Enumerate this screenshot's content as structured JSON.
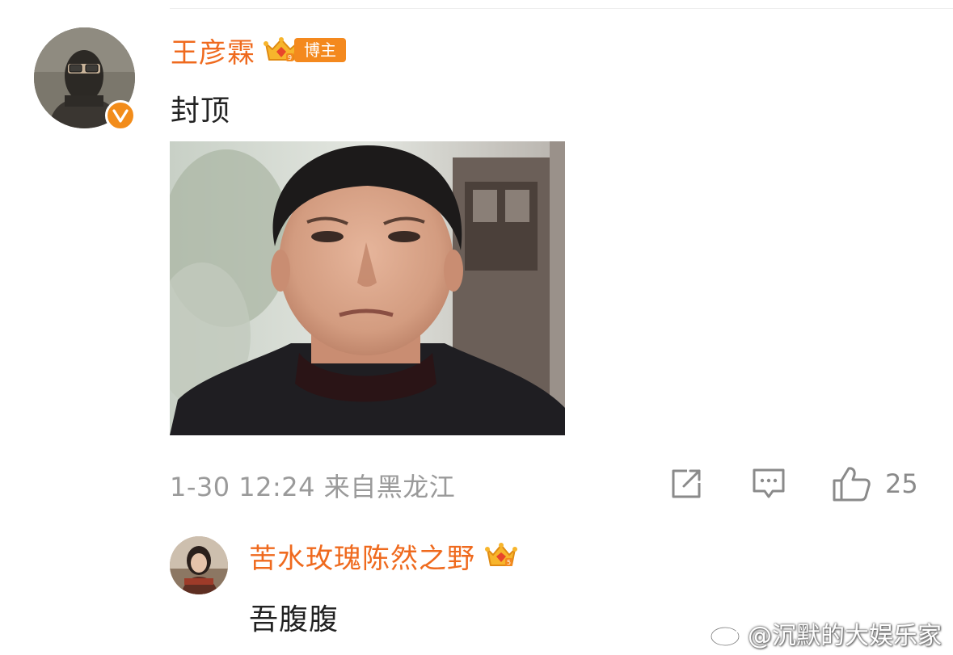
{
  "comment": {
    "username": "王彦霖",
    "badge_label": "博主",
    "text": "封顶",
    "timestamp": "1-30 12:24",
    "location": "来自黑龙江",
    "like_count": "25"
  },
  "reply": {
    "username": "苦水玫瑰陈然之野",
    "text": "吾腹腹"
  },
  "watermark": {
    "text": "@沉默的大娱乐家"
  },
  "icons": {
    "verified": "verified-v-icon",
    "crown": "crown-icon",
    "share": "share-icon",
    "comment": "comment-icon",
    "like": "thumbs-up-icon",
    "weibo": "weibo-logo-icon"
  },
  "colors": {
    "username": "#ef6a1e",
    "badge": "#f4891e",
    "meta": "#9a9a9a",
    "verified": "#f28c1a"
  }
}
